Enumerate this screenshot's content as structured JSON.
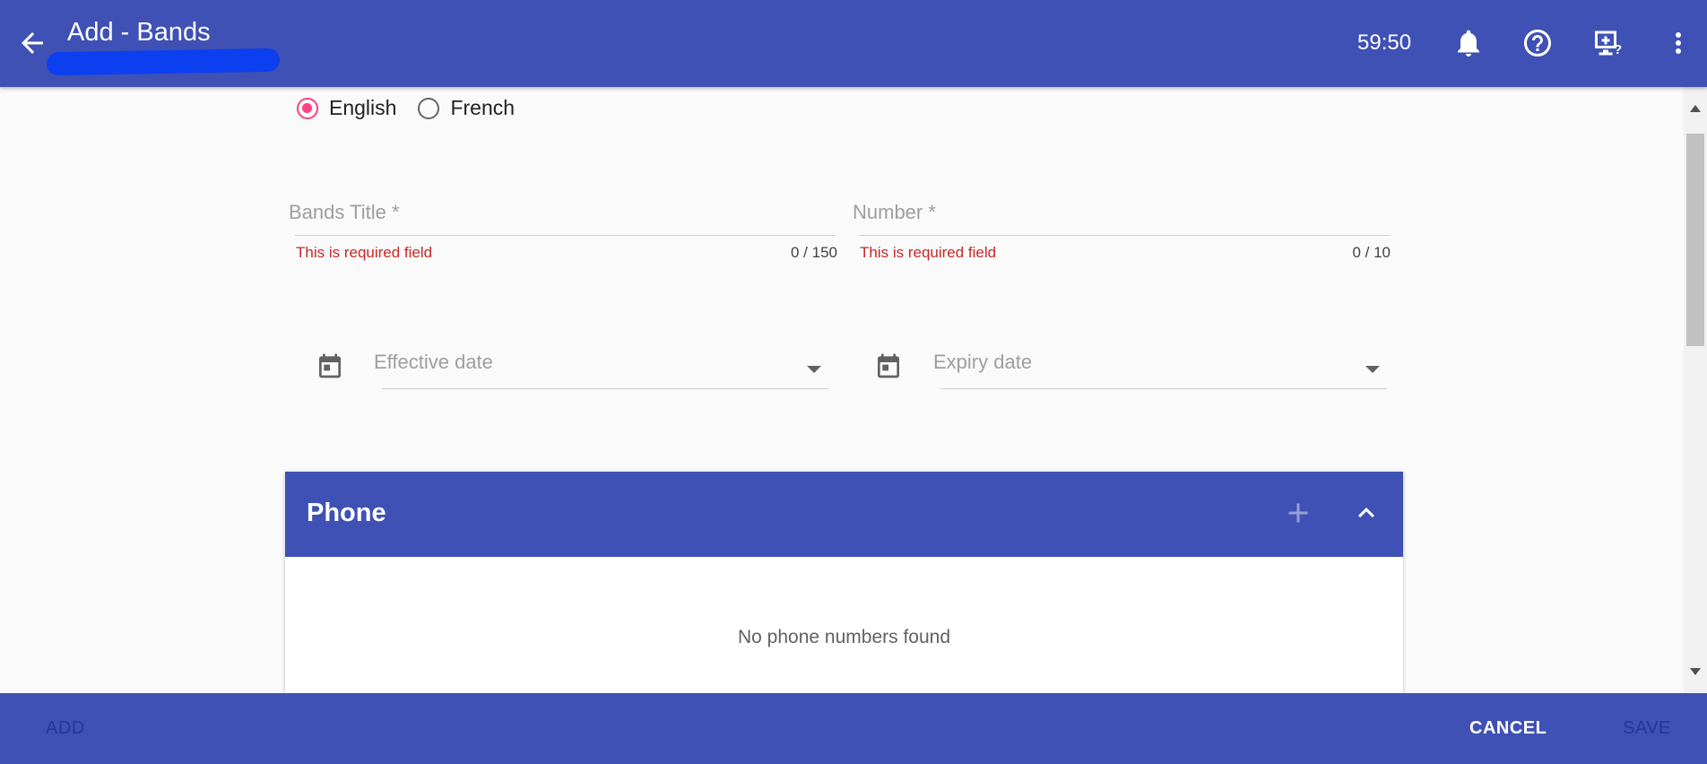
{
  "header": {
    "title": "Add - Bands",
    "timer": "59:50",
    "icons": [
      "back-arrow-icon",
      "notifications-bell-icon",
      "help-icon",
      "screen-help-icon",
      "more-vert-icon"
    ]
  },
  "language": {
    "options": [
      {
        "label": "English",
        "selected": true
      },
      {
        "label": "French",
        "selected": false
      }
    ]
  },
  "form": {
    "title_field": {
      "label": "Bands Title *",
      "error": "This is required field",
      "counter": "0 / 150"
    },
    "number_field": {
      "label": "Number *",
      "error": "This is required field",
      "counter": "0 / 10"
    },
    "effective_date": {
      "label": "Effective date"
    },
    "expiry_date": {
      "label": "Expiry date"
    }
  },
  "phone_panel": {
    "title": "Phone",
    "empty_message": "No phone numbers found"
  },
  "footer": {
    "add_label": "ADD",
    "cancel_label": "CANCEL",
    "save_label": "SAVE"
  },
  "colors": {
    "primary": "#3f51b5",
    "accent": "#ff4081",
    "error": "#c62828"
  }
}
